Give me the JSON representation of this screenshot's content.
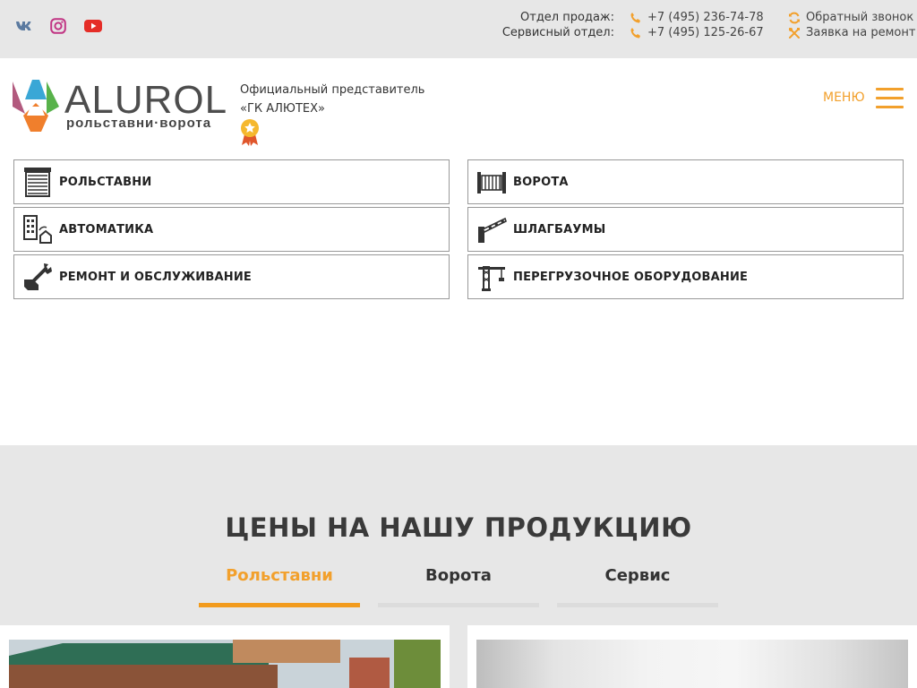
{
  "topbar": {
    "social": [
      {
        "name": "vk",
        "color": "#5b7aa0"
      },
      {
        "name": "instagram",
        "color": "#c13584"
      },
      {
        "name": "youtube",
        "color": "#e52d27"
      }
    ],
    "sales_label": "Отдел продаж:",
    "service_label": "Сервисный отдел:",
    "sales_phone": "+7 (495) 236-74-78",
    "service_phone": "+7 (495) 125-26-67",
    "callback": "Обратный звонок",
    "repair_request": "Заявка на ремонт",
    "accent": "#f2a02c"
  },
  "header": {
    "logo_word": "ALUROL",
    "logo_sub": "рольставни·ворота",
    "rep_line1": "Официальный представитель",
    "rep_line2": "«ГК АЛЮТЕХ»",
    "menu_label": "МЕНЮ"
  },
  "categories": [
    {
      "label": "РОЛЬСТАВНИ",
      "icon": "roller-shutter-icon"
    },
    {
      "label": "ВОРОТА",
      "icon": "gate-icon"
    },
    {
      "label": "АВТОМАТИКА",
      "icon": "automation-icon"
    },
    {
      "label": "ШЛАГБАУМЫ",
      "icon": "barrier-icon"
    },
    {
      "label": "РЕМОНТ И ОБСЛУЖИВАНИЕ",
      "icon": "wrench-icon"
    },
    {
      "label": "ПЕРЕГРУЗОЧНОЕ ОБОРУДОВАНИЕ",
      "icon": "crane-icon"
    }
  ],
  "prices": {
    "title": "ЦЕНЫ НА НАШУ ПРОДУКЦИЮ",
    "tabs": [
      {
        "label": "Рольставни",
        "active": true
      },
      {
        "label": "Ворота",
        "active": false
      },
      {
        "label": "Сервис",
        "active": false
      }
    ]
  }
}
